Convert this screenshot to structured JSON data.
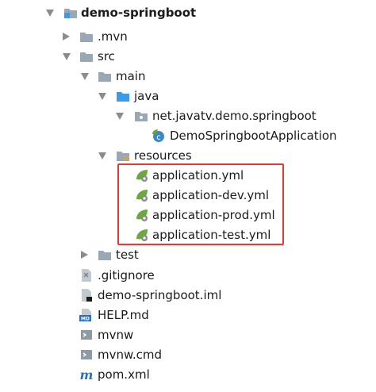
{
  "project_tree": {
    "root": "demo-springboot",
    "mvn": ".mvn",
    "src": "src",
    "main": "main",
    "java": "java",
    "package": "net.javatv.demo.springboot",
    "app_class": "DemoSpringbootApplication",
    "resources": "resources",
    "yml_files": [
      "application.yml",
      "application-dev.yml",
      "application-prod.yml",
      "application-test.yml"
    ],
    "test": "test",
    "gitignore": ".gitignore",
    "iml": "demo-springboot.iml",
    "help": "HELP.md",
    "help_badge": "MD",
    "mvnw": "mvnw",
    "mvnw_cmd": "mvnw.cmd",
    "pom": "pom.xml",
    "pom_glyph": "m"
  },
  "colors": {
    "highlight": "#e53935",
    "folder": "#9aa7b4",
    "source_folder": "#3c9be6",
    "resources_stripe": "#e6a23c",
    "spring_leaf": "#6aaa3a",
    "class_icon": "#3f88c5",
    "maven": "#2f6fb5"
  }
}
